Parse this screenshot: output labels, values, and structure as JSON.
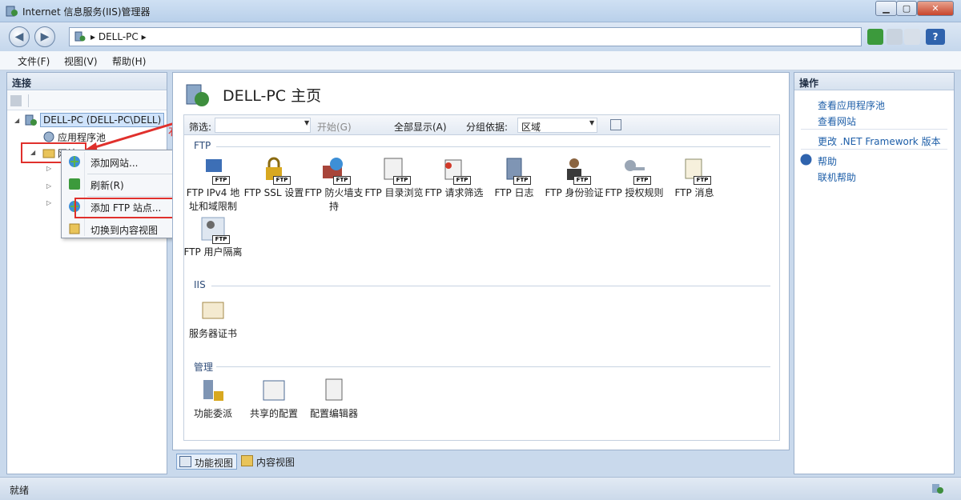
{
  "window": {
    "title": "Internet 信息服务(IIS)管理器",
    "min_symbol": "▁",
    "max_symbol": "▢",
    "close_symbol": "✕"
  },
  "address": {
    "path": "DELL-PC",
    "separator": "▸",
    "nav_back": "◀",
    "nav_forward": "▶",
    "help_symbol": "?"
  },
  "menu": [
    "文件(F)",
    "视图(V)",
    "帮助(H)"
  ],
  "connections": {
    "header": "连接",
    "tree": {
      "server": "DELL-PC (DELL-PC\\DELL)",
      "app_pools": "应用程序池",
      "sites": "网站"
    }
  },
  "context_menu": {
    "items": [
      "添加网站...",
      "刷新(R)",
      "添加 FTP 站点...",
      "切换到内容视图"
    ]
  },
  "annotation": {
    "label": "右键"
  },
  "main": {
    "title": "DELL-PC 主页",
    "filter": {
      "label": "筛选:",
      "start": "开始(G)",
      "show_all": "全部显示(A)",
      "group_by": "分组依据:",
      "group_value": "区域"
    },
    "sections": [
      {
        "name": "FTP",
        "features": [
          "FTP IPv4 地址和域限制",
          "FTP SSL 设置",
          "FTP 防火墙支持",
          "FTP 目录浏览",
          "FTP 请求筛选",
          "FTP 日志",
          "FTP 身份验证",
          "FTP 授权规则",
          "FTP 消息",
          "FTP 用户隔离"
        ]
      },
      {
        "name": "IIS",
        "features": [
          "服务器证书"
        ]
      },
      {
        "name": "管理",
        "features": [
          "功能委派",
          "共享的配置",
          "配置编辑器"
        ]
      }
    ],
    "ftp_tag": "FTP",
    "tabs": [
      "功能视图",
      "内容视图"
    ]
  },
  "actions": {
    "header": "操作",
    "group1": [
      "查看应用程序池",
      "查看网站"
    ],
    "group2": [
      "更改 .NET Framework 版本"
    ],
    "group3": [
      "帮助",
      "联机帮助"
    ]
  },
  "status": {
    "text": "就绪"
  },
  "colors": {
    "accent": "#1d5ea8",
    "highlight": "#e0302c",
    "panel_border": "#9cb1cc"
  }
}
